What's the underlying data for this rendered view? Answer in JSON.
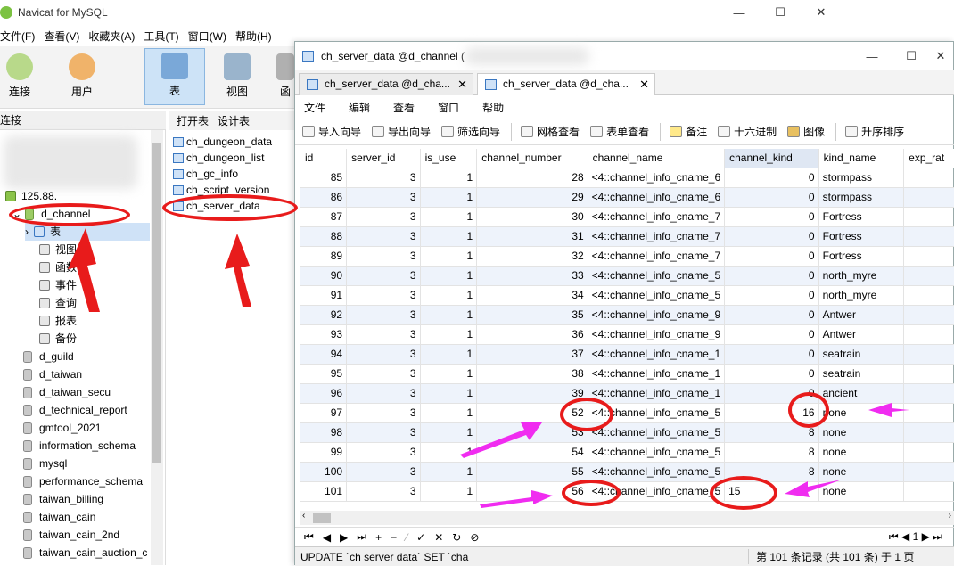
{
  "app": {
    "title": "Navicat for MySQL"
  },
  "menubar": [
    "文件(F)",
    "查看(V)",
    "收藏夹(A)",
    "工具(T)",
    "窗口(W)",
    "帮助(H)"
  ],
  "toolbar": {
    "connect": "连接",
    "user": "用户",
    "table": "表",
    "view": "视图",
    "fn": "函"
  },
  "connection_header": "连接",
  "tree": {
    "server": "125.88.",
    "active_db": "d_channel",
    "children": [
      "表",
      "视图",
      "函数",
      "事件",
      "查询",
      "报表",
      "备份"
    ],
    "databases": [
      "d_guild",
      "d_taiwan",
      "d_taiwan_secu",
      "d_technical_report",
      "gmtool_2021",
      "information_schema",
      "mysql",
      "performance_schema",
      "taiwan_billing",
      "taiwan_cain",
      "taiwan_cain_2nd",
      "taiwan_cain_auction_c"
    ]
  },
  "object_toolbar": {
    "open": "打开表",
    "design": "设计表"
  },
  "objects": [
    "ch_dungeon_data",
    "ch_dungeon_list",
    "ch_gc_info",
    "ch_script_version",
    "ch_server_data"
  ],
  "win2": {
    "title": "ch_server_data @d_channel ("
  },
  "tabs": [
    "ch_server_data @d_cha...",
    "ch_server_data @d_cha..."
  ],
  "menu2": [
    "文件",
    "编辑",
    "查看",
    "窗口",
    "帮助"
  ],
  "tool2": [
    "导入向导",
    "导出向导",
    "筛选向导",
    "网格查看",
    "表单查看",
    "备注",
    "十六进制",
    "图像",
    "升序排序"
  ],
  "columns": [
    "id",
    "server_id",
    "is_use",
    "channel_number",
    "channel_name",
    "channel_kind",
    "kind_name",
    "exp_rat"
  ],
  "rows": [
    [
      "85",
      "3",
      "1",
      "28",
      "<4::channel_info_cname_6",
      "0",
      "stormpass"
    ],
    [
      "86",
      "3",
      "1",
      "29",
      "<4::channel_info_cname_6",
      "0",
      "stormpass"
    ],
    [
      "87",
      "3",
      "1",
      "30",
      "<4::channel_info_cname_7",
      "0",
      "Fortress"
    ],
    [
      "88",
      "3",
      "1",
      "31",
      "<4::channel_info_cname_7",
      "0",
      "Fortress"
    ],
    [
      "89",
      "3",
      "1",
      "32",
      "<4::channel_info_cname_7",
      "0",
      "Fortress"
    ],
    [
      "90",
      "3",
      "1",
      "33",
      "<4::channel_info_cname_5",
      "0",
      "north_myre"
    ],
    [
      "91",
      "3",
      "1",
      "34",
      "<4::channel_info_cname_5",
      "0",
      "north_myre"
    ],
    [
      "92",
      "3",
      "1",
      "35",
      "<4::channel_info_cname_9",
      "0",
      "Antwer"
    ],
    [
      "93",
      "3",
      "1",
      "36",
      "<4::channel_info_cname_9",
      "0",
      "Antwer"
    ],
    [
      "94",
      "3",
      "1",
      "37",
      "<4::channel_info_cname_1",
      "0",
      "seatrain"
    ],
    [
      "95",
      "3",
      "1",
      "38",
      "<4::channel_info_cname_1",
      "0",
      "seatrain"
    ],
    [
      "96",
      "3",
      "1",
      "39",
      "<4::channel_info_cname_1",
      "0",
      "ancient"
    ],
    [
      "97",
      "3",
      "1",
      "52",
      "<4::channel_info_cname_5",
      "16",
      "none"
    ],
    [
      "98",
      "3",
      "1",
      "53",
      "<4::channel_info_cname_5",
      "8",
      "none"
    ],
    [
      "99",
      "3",
      "1",
      "54",
      "<4::channel_info_cname_5",
      "8",
      "none"
    ],
    [
      "100",
      "3",
      "1",
      "55",
      "<4::channel_info_cname_5",
      "8",
      "none"
    ],
    [
      "101",
      "3",
      "1",
      "56",
      "<4::channel_info_cname_5",
      "15",
      "none"
    ]
  ],
  "status": {
    "sql": "UPDATE `ch server data` SET `cha",
    "records": "第 101 条记录 (共 101 条) 于 1 页",
    "page": "1"
  },
  "colors": {
    "annotation_red": "#e81b1b",
    "annotation_magenta": "#f02cf0",
    "row_alt": "#eef3fb"
  }
}
